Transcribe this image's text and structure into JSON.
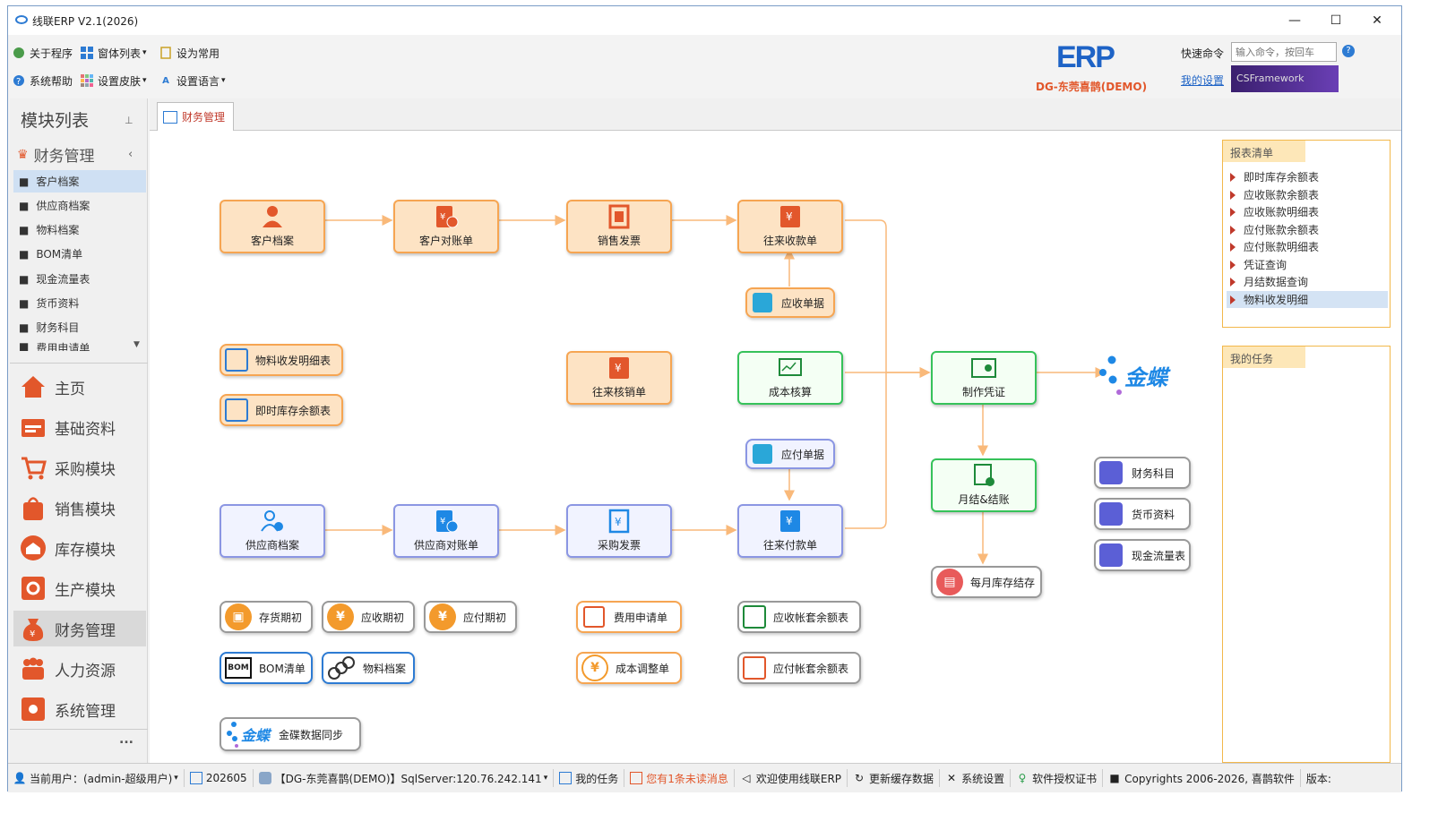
{
  "app": {
    "title": "线联ERP V2.1(2026)",
    "company": "DG-东莞喜鹊(DEMO)",
    "logo_text": "ERP"
  },
  "toolbar": {
    "about": "关于程序",
    "windows": "窗体列表",
    "set_common": "设为常用",
    "help": "系统帮助",
    "skin": "设置皮肤",
    "language": "设置语言",
    "quick_cmd_label": "快速命令",
    "quick_cmd_placeholder": "输入命令，按回车",
    "my_settings": "我的设置",
    "framework": "CSFramework"
  },
  "sidebar": {
    "title": "模块列表",
    "group": "财务管理",
    "items": [
      {
        "label": "客户档案"
      },
      {
        "label": "供应商档案"
      },
      {
        "label": "物料档案"
      },
      {
        "label": "BOM清单"
      },
      {
        "label": "现金流量表"
      },
      {
        "label": "货币资料"
      },
      {
        "label": "财务科目"
      },
      {
        "label": "费用申请单"
      }
    ],
    "modules": [
      {
        "label": "主页"
      },
      {
        "label": "基础资料"
      },
      {
        "label": "采购模块"
      },
      {
        "label": "销售模块"
      },
      {
        "label": "库存模块"
      },
      {
        "label": "生产模块"
      },
      {
        "label": "财务管理"
      },
      {
        "label": "人力资源"
      },
      {
        "label": "系统管理"
      }
    ],
    "more": "..."
  },
  "tab": {
    "label": "财务管理"
  },
  "flow": {
    "customer": "客户档案",
    "cust_reconcile": "客户对账单",
    "sales_invoice": "销售发票",
    "receivable": "往来收款单",
    "recv_doc": "应收单据",
    "mat_detail": "物料收发明细表",
    "stock_balance": "即时库存余额表",
    "writeoff": "往来核销单",
    "cost_calc": "成本核算",
    "voucher": "制作凭证",
    "kingdee": "金蝶",
    "pay_doc": "应付单据",
    "month_close": "月结&结账",
    "supplier": "供应商档案",
    "supp_reconcile": "供应商对账单",
    "purchase_invoice": "采购发票",
    "payment": "往来付款单",
    "monthly_stock": "每月库存结存",
    "fin_subject": "财务科目",
    "currency": "货币资料",
    "cashflow": "现金流量表",
    "inv_init": "存货期初",
    "ar_init": "应收期初",
    "ap_init": "应付期初",
    "bom": "BOM清单",
    "mat_file": "物料档案",
    "expense": "费用申请单",
    "cost_adjust": "成本调整单",
    "ar_balance": "应收帐套余额表",
    "ap_balance": "应付帐套余额表",
    "kd_sync": "金碟数据同步",
    "bom_icon": "BOM"
  },
  "reports": {
    "title": "报表清单",
    "items": [
      "即时库存余额表",
      "应收账款余额表",
      "应收账款明细表",
      "应付账款余额表",
      "应付账款明细表",
      "凭证查询",
      "月结数据查询",
      "物料收发明细"
    ]
  },
  "tasks": {
    "title": "我的任务"
  },
  "status": {
    "user": "当前用户：(admin-超级用户)",
    "period": "202605",
    "db": "【DG-东莞喜鹊(DEMO)】SqlServer:120.76.242.141",
    "my_tasks": "我的任务",
    "unread": "您有1条未读消息",
    "welcome": "欢迎使用线联ERP",
    "refresh": "更新缓存数据",
    "settings": "系统设置",
    "license": "软件授权证书",
    "copyright": "Copyrights 2006-2026, 喜鹊软件",
    "version": "版本:"
  },
  "colors": {
    "orange": "#f6a552",
    "green": "#36c25a",
    "blue": "#8b96e3",
    "kingdee": "#1e88e5",
    "accent_red": "#c0392b"
  }
}
